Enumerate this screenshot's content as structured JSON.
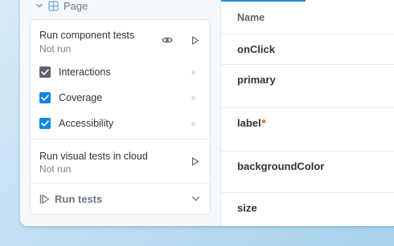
{
  "sidebar": {
    "page_label": "Page",
    "component_tests": {
      "title": "Run component tests",
      "status": "Not run"
    },
    "checks": [
      {
        "label": "Interactions",
        "checked": true,
        "style": "gray"
      },
      {
        "label": "Coverage",
        "checked": true,
        "style": "blue"
      },
      {
        "label": "Accessibility",
        "checked": true,
        "style": "blue"
      }
    ],
    "visual_tests": {
      "title": "Run visual tests in cloud",
      "status": "Not run"
    },
    "run_tests_label": "Run tests"
  },
  "args_table": {
    "header": "Name",
    "rows": [
      {
        "name": "onClick",
        "required": false
      },
      {
        "name": "primary",
        "required": false
      },
      {
        "name": "label",
        "required": true,
        "required_mark": "*"
      },
      {
        "name": "backgroundColor",
        "required": false
      },
      {
        "name": "size",
        "required": false
      }
    ]
  },
  "colors": {
    "accent": "#0e86e2",
    "required": "#ff4400",
    "tab_indicator": "#1e8fe8"
  },
  "icons": [
    "chevron-down-icon",
    "grid-icon",
    "eye-icon",
    "play-icon",
    "check-icon",
    "run-tests-icon"
  ]
}
